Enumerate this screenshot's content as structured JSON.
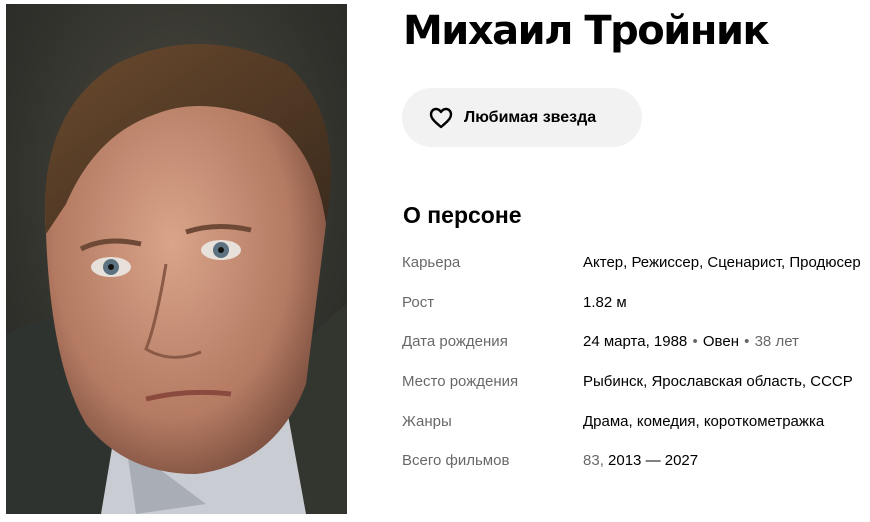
{
  "person": {
    "name": "Михаил Тройник",
    "photo_alt": "Михаил Тройник"
  },
  "favorite_button": {
    "label": "Любимая звезда",
    "icon": "heart-outline-icon"
  },
  "about": {
    "title": "О персоне",
    "career": {
      "label": "Карьера",
      "value": "Актер, Режиссер, Сценарист, Продюсер"
    },
    "height": {
      "label": "Рост",
      "value": "1.82 м"
    },
    "birth_date": {
      "label": "Дата рождения",
      "date": "24 марта, 1988",
      "sep1": "•",
      "zodiac": "Овен",
      "sep2": "•",
      "age": "38 лет"
    },
    "birth_place": {
      "label": "Место рождения",
      "value": "Рыбинск, Ярославская область, СССР"
    },
    "genres": {
      "label": "Жанры",
      "value": "Драма, комедия, короткометражка"
    },
    "total_films": {
      "label": "Всего фильмов",
      "count": "83",
      "comma": ",",
      "years": "2013 — 2027"
    }
  },
  "colors": {
    "button_bg": "#f2f2f2",
    "muted_text": "rgba(0,0,0,0.6)",
    "text": "#000000"
  }
}
